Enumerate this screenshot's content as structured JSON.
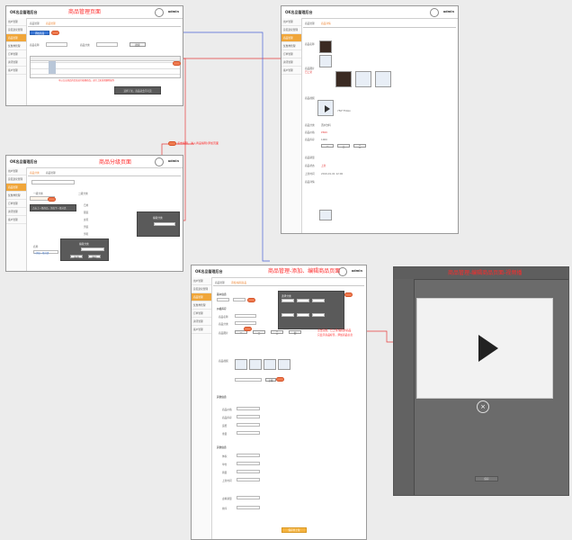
{
  "app": {
    "brand": "OK名品管理后台",
    "user": "admin"
  },
  "sidebar_items": [
    "用户管理",
    "意见建议管理",
    "商品管理",
    "优惠券管理",
    "订单管理",
    "资讯管理",
    "客户管理",
    "系统设置"
  ],
  "screens": {
    "product_mgmt": {
      "title": "商品管理页面"
    },
    "category": {
      "title": "商品分级页面"
    },
    "add_edit": {
      "title": "商品管理-添加、编辑商品页面"
    },
    "preview": {
      "title": "商品管理-编辑商品页面-视频播"
    }
  },
  "product_mgmt": {
    "breadcrumb": "商品管理",
    "tab_active": "商品管理",
    "filter_label_a": "商品名称",
    "filter_label_b": "商品分类",
    "search_btn": "搜索",
    "add_btn": "添加商品",
    "table_headers": [
      "",
      "ID",
      "商品",
      "名称",
      "分类",
      "价格",
      "库存",
      "销量",
      "状态",
      "操作"
    ],
    "row_actions": [
      "下架",
      "编辑",
      "删除"
    ],
    "note": "可以点击商品的信息进行编辑修改，进行上架或者删除操作",
    "dark_note": "选择下架，商品就会不可见",
    "edit_badge": "编辑"
  },
  "category": {
    "tab_a": "商品分类",
    "tab_b": "商品管理",
    "note": "点击上一级商品，添加下一级分类",
    "col_a": "一级分类",
    "col_b": "二级分类",
    "items": [
      "日用",
      "服装",
      "女鞋",
      "男装",
      "男鞋"
    ],
    "popup_title": "编辑分类",
    "popup_label": "分类名称",
    "popup_btns": [
      "取消",
      "确定"
    ],
    "add_first": "+添加一级分类",
    "input_label": "名称"
  },
  "arrow_note": "点击编辑，进入商品编辑/添加页面",
  "detail": {
    "breadcrumb": [
      "商品管理",
      "商品详情"
    ],
    "fields": [
      "商品名称",
      "商品图片",
      "商品视频",
      "商品分类",
      "商品价格",
      "商品库存",
      "商品销量",
      "商品状态",
      "上架时间",
      "商品详情"
    ],
    "values": [
      "红酒",
      "",
      "",
      "酒水饮料",
      "¥699",
      "1000",
      "120",
      "上架",
      "2019-01-01 12:00",
      ""
    ],
    "status_red": "已上架",
    "image_hint": "750*750px"
  },
  "add_edit": {
    "breadcrumb": [
      "商品管理",
      "添加/编辑商品"
    ],
    "section_basic": "基本信息",
    "section_price": "价格库存",
    "section_other": "其他信息",
    "labels": [
      "商品名称",
      "商品分类",
      "商品图片",
      "商品视频",
      "商品详情",
      "商品价格",
      "商品库存",
      "运费",
      "重量",
      "体积",
      "单位",
      "销量",
      "上架时间",
      "虚拟销量",
      "排序"
    ],
    "popup_title": "选择分类",
    "popup_btns": [
      "取消",
      "确定"
    ],
    "upload_btn": "上传",
    "note_lines": [
      "点击完成，已上传/编辑的商品",
      "只显示商品标签，添加商品信息"
    ],
    "save_btn": "保存并上架",
    "tag_btns": [
      "一",
      "二",
      "三",
      "四"
    ]
  },
  "preview": {
    "close_symbol": "×",
    "save_btn": "保存"
  }
}
